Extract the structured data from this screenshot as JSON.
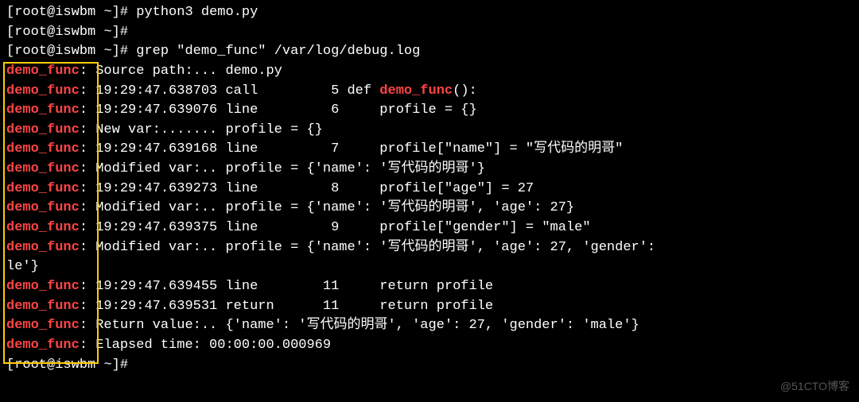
{
  "prompt_user": "root",
  "prompt_host": "iswbm",
  "prompt_dir": "~",
  "cmd1": "python3 demo.py",
  "cmd2": "",
  "cmd3": "grep \"demo_func\" /var/log/debug.log",
  "tag": "demo_func",
  "out": {
    "l1_rest": " Source path:... demo.py",
    "l2_a": " 19:29:47.638703 call         5 def ",
    "l2_fn": "demo_func",
    "l2_b": "():",
    "l3": " 19:29:47.639076 line         6     profile = {}",
    "l4": " New var:....... profile = {}",
    "l5": " 19:29:47.639168 line         7     profile[\"name\"] = \"写代码的明哥\"",
    "l6": " Modified var:.. profile = {'name': '写代码的明哥'}",
    "l7": " 19:29:47.639273 line         8     profile[\"age\"] = 27",
    "l8": " Modified var:.. profile = {'name': '写代码的明哥', 'age': 27}",
    "l9": " 19:29:47.639375 line         9     profile[\"gender\"] = \"male\"",
    "l10a": " Modified var:.. profile = {'name': '写代码的明哥', 'age': 27, 'gender':",
    "l10b": "le'}",
    "l11": " 19:29:47.639455 line        11     return profile",
    "l12": " 19:29:47.639531 return      11     return profile",
    "l13": " Return value:.. {'name': '写代码的明哥', 'age': 27, 'gender': 'male'}",
    "l14": " Elapsed time: 00:00:00.000969"
  },
  "watermark": "@51CTO博客"
}
